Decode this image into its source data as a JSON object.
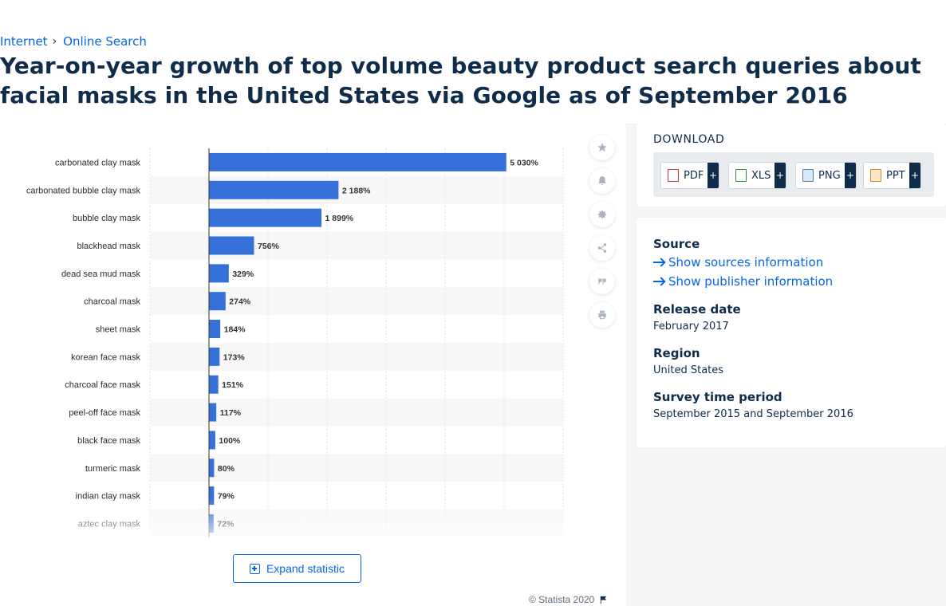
{
  "breadcrumb": [
    "Internet",
    "Online Search"
  ],
  "title": "Year-on-year growth of top volume beauty product search queries about facial masks in the United States via Google as of September 2016",
  "expand_label": "Expand statistic",
  "copyright": "© Statista 2020",
  "download": {
    "title": "DOWNLOAD",
    "formats": [
      "PDF",
      "XLS",
      "PNG",
      "PPT"
    ],
    "plus": "+"
  },
  "info": {
    "source_heading": "Source",
    "show_sources": "Show sources information",
    "show_publisher": "Show publisher information",
    "release_heading": "Release date",
    "release_value": "February 2017",
    "region_heading": "Region",
    "region_value": "United States",
    "survey_heading": "Survey time period",
    "survey_value": "September 2015 and September 2016"
  },
  "colors": {
    "bar": "#3571d8",
    "accent": "#0666e5"
  },
  "chart_data": {
    "type": "bar",
    "orientation": "horizontal",
    "categories": [
      "carbonated clay mask",
      "carbonated bubble clay mask",
      "bubble clay mask",
      "blackhead mask",
      "dead sea mud mask",
      "charcoal mask",
      "sheet mask",
      "korean face mask",
      "charcoal face mask",
      "peel-off face mask",
      "black face mask",
      "turmeric mask",
      "indian clay mask",
      "aztec clay mask"
    ],
    "values": [
      5030,
      2188,
      1899,
      756,
      329,
      274,
      184,
      173,
      151,
      117,
      100,
      80,
      79,
      72
    ],
    "value_labels": [
      "5 030%",
      "2 188%",
      "1 899%",
      "756%",
      "329%",
      "274%",
      "184%",
      "173%",
      "151%",
      "117%",
      "100%",
      "80%",
      "79%",
      "72%"
    ],
    "xlim": [
      -1000,
      6000
    ],
    "grid": true,
    "unit": "%"
  }
}
